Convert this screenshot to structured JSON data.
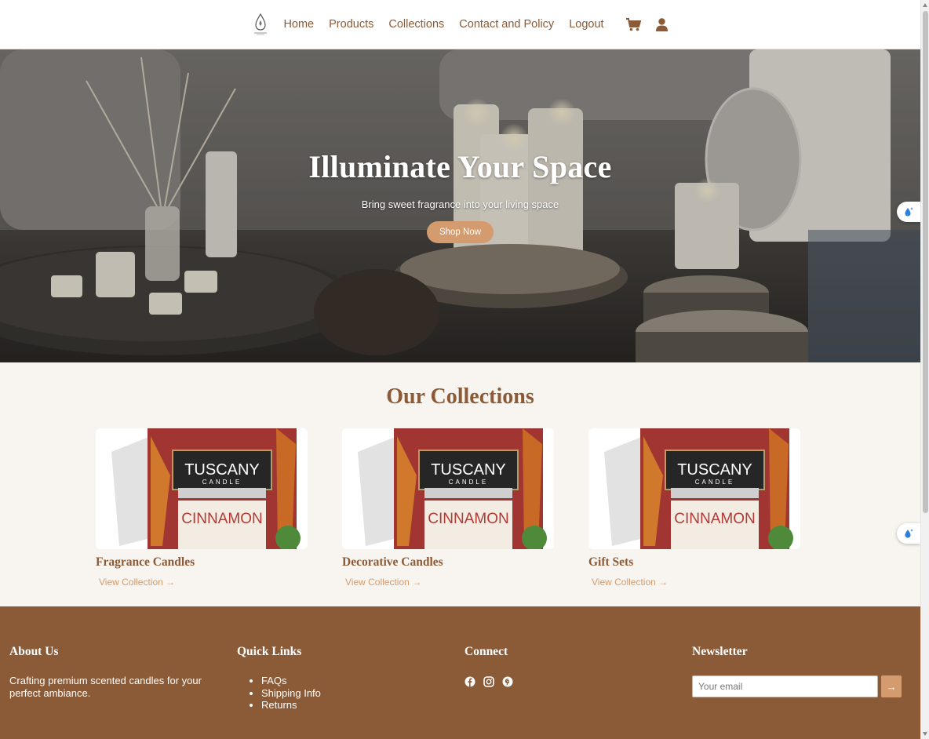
{
  "nav": {
    "logo_icon": "candle-logo-icon",
    "links": [
      "Home",
      "Products",
      "Collections",
      "Contact and Policy",
      "Logout"
    ],
    "cart_icon": "cart-icon",
    "user_icon": "user-icon"
  },
  "hero": {
    "title": "Illuminate Your Space",
    "subtitle": "Bring sweet fragrance into your living space",
    "cta": "Shop Now"
  },
  "collections": {
    "heading": "Our Collections",
    "items": [
      {
        "name": "Fragrance Candles",
        "link": "View Collection →",
        "image_label": "TUSCANY",
        "image_sub": "CANDLE",
        "image_flavor": "CINNAMON"
      },
      {
        "name": "Decorative Candles",
        "link": "View Collection →",
        "image_label": "TUSCANY",
        "image_sub": "CANDLE",
        "image_flavor": "CINNAMON"
      },
      {
        "name": "Gift Sets",
        "link": "View Collection →",
        "image_label": "TUSCANY",
        "image_sub": "CANDLE",
        "image_flavor": "CINNAMON"
      }
    ]
  },
  "footer": {
    "about": {
      "heading": "About Us",
      "text": "Crafting premium scented candles for your perfect ambiance."
    },
    "quick_links": {
      "heading": "Quick Links",
      "items": [
        "FAQs",
        "Shipping Info",
        "Returns"
      ]
    },
    "connect": {
      "heading": "Connect",
      "icons": [
        "facebook-icon",
        "instagram-icon",
        "pinterest-icon"
      ]
    },
    "newsletter": {
      "heading": "Newsletter",
      "placeholder": "Your email",
      "button": "→"
    }
  },
  "colors": {
    "brand": "#8b5a36",
    "accent": "#d39b6e",
    "background": "#f8f4ef"
  }
}
